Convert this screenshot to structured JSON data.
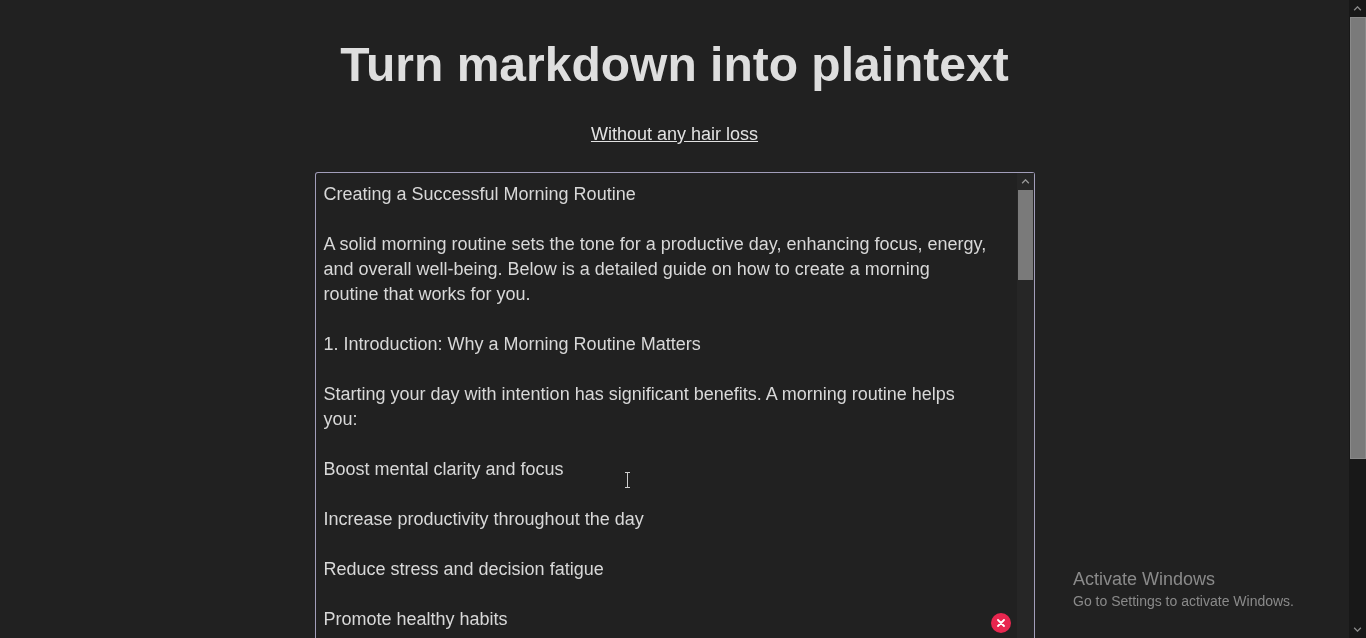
{
  "title": "Turn markdown into plaintext",
  "subtitle_link": "Without any hair loss",
  "editor": {
    "paragraphs": [
      "Creating a Successful Morning Routine",
      "A solid morning routine sets the tone for a productive day, enhancing focus, energy,\nand overall well-being. Below is a detailed guide on how to create a morning\nroutine that works for you.",
      "1. Introduction: Why a Morning Routine Matters",
      "Starting your day with intention has significant benefits. A morning routine helps\nyou:",
      "Boost mental clarity and focus",
      "Increase productivity throughout the day",
      "Reduce stress and decision fatigue",
      "Promote healthy habits"
    ]
  },
  "activation_notice": {
    "title": "Activate Windows",
    "message": "Go to Settings to activate Windows."
  }
}
